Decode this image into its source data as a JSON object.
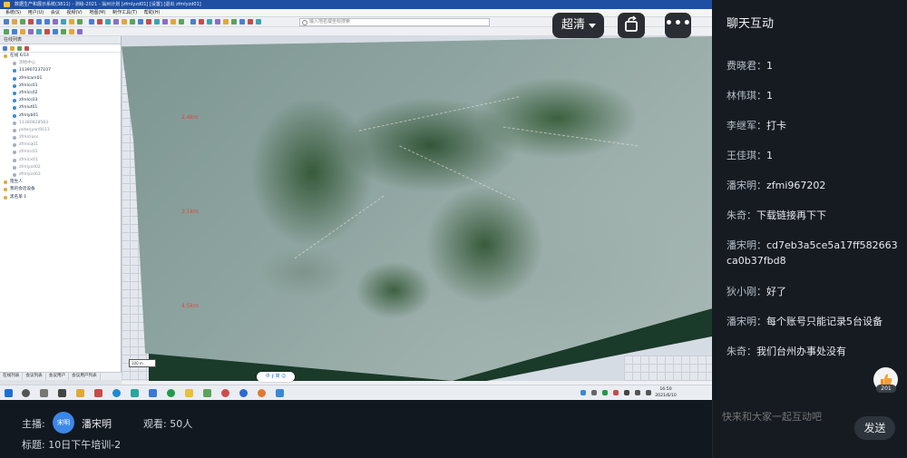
{
  "app": {
    "window_title": "数据生产和展示系统(3811) - 测绘-2021 - 翁州计划 [zfmlyzd01] [设置] [退出 zfmlyzd01]",
    "menu": [
      "系统(S)",
      "用户(U)",
      "会议",
      "视频(V)",
      "地图(M)",
      "制作工具(T)",
      "帮助(H)"
    ],
    "search_placeholder": "输入地名或坐标搜索",
    "panel_title": "在线列表",
    "tree": [
      {
        "label": "在线 6/14",
        "status": "group"
      },
      {
        "label": "测绘中心",
        "status": "offline"
      },
      {
        "label": "113907237107",
        "status": "online"
      },
      {
        "label": "zfmlcam01",
        "status": "online"
      },
      {
        "label": "zfmlcs01",
        "status": "online"
      },
      {
        "label": "zfmlcs02",
        "status": "online"
      },
      {
        "label": "zfmlcs03",
        "status": "online"
      },
      {
        "label": "zfmlut01",
        "status": "online"
      },
      {
        "label": "zfmlyb01",
        "status": "online"
      },
      {
        "label": "11380828583",
        "status": "offline"
      },
      {
        "label": "peterjyan9013",
        "status": "offline"
      },
      {
        "label": "zfmlcloss",
        "status": "offline"
      },
      {
        "label": "zfmlcq01",
        "status": "offline"
      },
      {
        "label": "zfmlcs01",
        "status": "offline"
      },
      {
        "label": "zfmlcx01",
        "status": "offline"
      },
      {
        "label": "zfmlyzd02",
        "status": "offline"
      },
      {
        "label": "zfmlyzd03",
        "status": "offline"
      },
      {
        "label": "陌生人",
        "status": "group"
      },
      {
        "label": "我的会话设备",
        "status": "group"
      },
      {
        "label": "黑名单 1",
        "status": "group"
      }
    ],
    "panel_tabs": [
      "在线列表",
      "会议列表",
      "会议用户",
      "会议用户列表"
    ],
    "map_labels": [
      "2.4km",
      "3.1km",
      "4.5km"
    ],
    "scale_text": "100 m",
    "float_tag": "中 ∮ 简 ☺",
    "clock_time": "16:50",
    "clock_date": "2021/6/10"
  },
  "controls": {
    "quality_label": "超清",
    "more_label": "•••"
  },
  "chat": {
    "title": "聊天互动",
    "messages": [
      {
        "user": "费晓君：",
        "text": "1"
      },
      {
        "user": "林伟琪：",
        "text": "1"
      },
      {
        "user": "李继军：",
        "text": "打卡"
      },
      {
        "user": "王佳琪：",
        "text": "1"
      },
      {
        "user": "潘宋明：",
        "text": "zfmi967202"
      },
      {
        "user": "朱奇：",
        "text": "下载链接再下下"
      },
      {
        "user": "潘宋明：",
        "text": "cd7eb3a5ce5a17ff582663ca0b37fbd8"
      },
      {
        "user": "狄小刚：",
        "text": "好了"
      },
      {
        "user": "潘宋明：",
        "text": "每个账号只能记录5台设备"
      },
      {
        "user": "朱奇：",
        "text": "我们台州办事处没有"
      }
    ],
    "like_count": "201",
    "input_placeholder": "快来和大家一起互动吧",
    "send_label": "发送"
  },
  "info": {
    "host_label": "主播:",
    "host_avatar_text": "宋明",
    "host_name": "潘宋明",
    "viewers": "观看: 50人",
    "title": "标题: 10日下午培训-2"
  },
  "colors": {
    "accent_blue": "#3b87e8",
    "panel_bg": "#161b22",
    "titlebar": "#1e4fa3"
  }
}
